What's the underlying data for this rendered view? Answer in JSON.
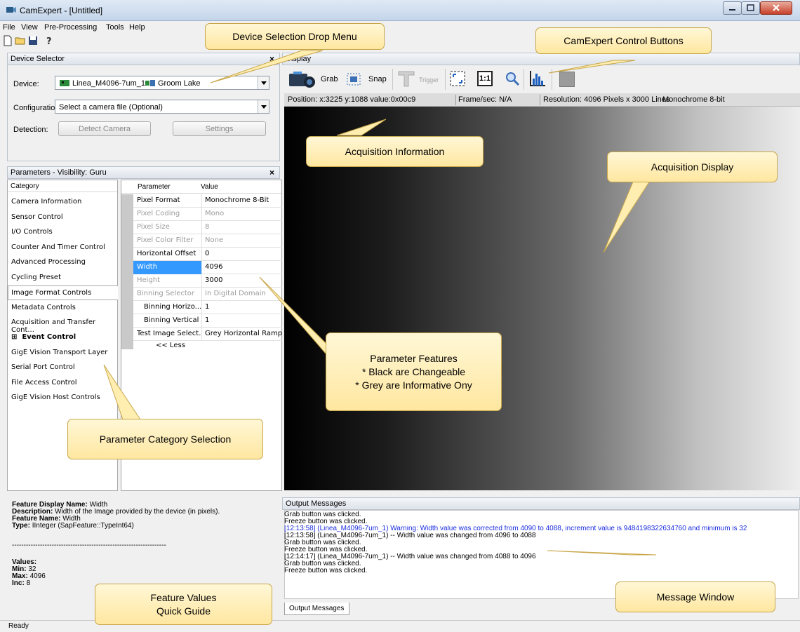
{
  "window": {
    "title": "CamExpert - [Untitled]"
  },
  "menu": [
    "File",
    "View",
    "Pre-Processing",
    "Tools",
    "Help"
  ],
  "device_selector": {
    "header": "Device Selector",
    "device_label": "Device:",
    "device_value": "Linea_M4096-7um_1",
    "device_extra": "Groom Lake",
    "config_label": "Configuration:",
    "config_value": "Select a camera file (Optional)",
    "detection_label": "Detection:",
    "detect_button": "Detect Camera",
    "settings_button": "Settings"
  },
  "parameters": {
    "header": "Parameters - Visibility: Guru",
    "category_header": "Category",
    "param_header": "Parameter",
    "value_header": "Value",
    "categories": [
      "Camera Information",
      "Sensor Control",
      "I/O Controls",
      "Counter And Timer Control",
      "Advanced Processing",
      "Cycling Preset",
      "Image Format Controls",
      "Metadata Controls",
      "Acquisition and Transfer Cont...",
      "Event Control",
      "GigE Vision Transport Layer",
      "Serial Port Control",
      "File Access Control",
      "GigE Vision Host Controls"
    ],
    "event_expander": "⊞",
    "rows": [
      {
        "name": "Pixel Format",
        "value": "Monochrome 8-Bit"
      },
      {
        "name": "Pixel Coding",
        "value": "Mono"
      },
      {
        "name": "Pixel Size",
        "value": "8"
      },
      {
        "name": "Pixel Color Filter",
        "value": "None"
      },
      {
        "name": "Horizontal Offset",
        "value": "0"
      },
      {
        "name": "Width",
        "value": "4096"
      },
      {
        "name": "Height",
        "value": "3000"
      },
      {
        "name": "Binning Selector",
        "value": "In Digital Domain"
      },
      {
        "name": "Binning Horizo...",
        "value": "1"
      },
      {
        "name": "Binning Vertical",
        "value": "1"
      },
      {
        "name": "Test Image Select...",
        "value": "Grey Horizontal Ramp"
      }
    ],
    "less_link": "<< Less"
  },
  "feature_guide": {
    "display_name_label": "Feature Display Name:",
    "display_name": "Width",
    "description_label": "Description:",
    "description": "Width of the Image provided by the device (in pixels).",
    "feature_name_label": "Feature Name:",
    "feature_name": "Width",
    "type_label": "Type:",
    "type": "IInteger (SapFeature::TypeInt64)",
    "separator": "------------------------------------------------------------------",
    "values_label": "Values:",
    "min_label": "Min:",
    "min": "32",
    "max_label": "Max:",
    "max": "4096",
    "inc_label": "Inc:",
    "inc": "8"
  },
  "display": {
    "header": "Display",
    "toolbar": {
      "grab": "Grab",
      "snap": "Snap",
      "trigger": "Trigger",
      "one_to_one": "1:1"
    },
    "position": "Position: x:3225 y:1088 value:0x00c9",
    "fps": "Frame/sec: N/A",
    "resolution": "Resolution: 4096 Pixels x 3000 Lines",
    "format": "Monochrome 8-bit"
  },
  "output": {
    "header": "Output Messages",
    "tab": "Output Messages",
    "messages": [
      {
        "text": "Grab button was clicked.",
        "color": "#000000"
      },
      {
        "text": "Freeze button was clicked.",
        "color": "#000000"
      },
      {
        "text": "[12:13:58] (Linea_M4096-7um_1)  Warning: Width value was corrected from 4090 to 4088, increment value is 9484198322634760 and minimum is 32",
        "color": "#1a2ce0"
      },
      {
        "text": "[12:13:58] (Linea_M4096-7um_1)  -- Width value was changed from 4096 to 4088",
        "color": "#000000"
      },
      {
        "text": "Grab button was clicked.",
        "color": "#000000"
      },
      {
        "text": "Freeze button was clicked.",
        "color": "#000000"
      },
      {
        "text": "[12:14:17] (Linea_M4096-7um_1)  -- Width value was changed from 4088 to 4096",
        "color": "#000000"
      },
      {
        "text": "Grab button was clicked.",
        "color": "#000000"
      },
      {
        "text": "Freeze button was clicked.",
        "color": "#000000"
      }
    ]
  },
  "status": {
    "text": "Ready"
  },
  "callouts": {
    "device_dropdown": "Device Selection Drop Menu",
    "control_buttons": "CamExpert Control Buttons",
    "acq_info": "Acquisition Information",
    "acq_display": "Acquisition Display",
    "param_features_1": "Parameter Features",
    "param_features_2": "* Black are Changeable",
    "param_features_3": "* Grey are Informative Ony",
    "category_selection": "Parameter Category Selection",
    "feature_values_1": "Feature Values",
    "feature_values_2": "Quick Guide",
    "message_window": "Message Window"
  }
}
